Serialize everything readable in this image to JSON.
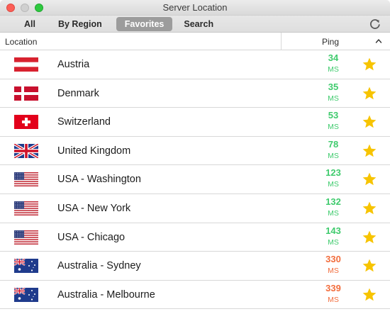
{
  "window": {
    "title": "Server Location"
  },
  "tabs": [
    {
      "label": "All"
    },
    {
      "label": "By Region"
    },
    {
      "label": "Favorites"
    },
    {
      "label": "Search"
    }
  ],
  "columns": {
    "location": "Location",
    "ping": "Ping"
  },
  "colors": {
    "ping_good": "#3fcb6d",
    "ping_bad": "#f26d3d",
    "star": "#f7c400",
    "active_tab": "#9c9c9c"
  },
  "rows": [
    {
      "flag": "austria-flag",
      "name": "Austria",
      "ping": "34",
      "unit": "MS",
      "status": "good"
    },
    {
      "flag": "denmark-flag",
      "name": "Denmark",
      "ping": "35",
      "unit": "MS",
      "status": "good"
    },
    {
      "flag": "switzerland-flag",
      "name": "Switzerland",
      "ping": "53",
      "unit": "MS",
      "status": "good"
    },
    {
      "flag": "uk-flag",
      "name": "United Kingdom",
      "ping": "78",
      "unit": "MS",
      "status": "good"
    },
    {
      "flag": "usa-flag",
      "name": "USA - Washington",
      "ping": "123",
      "unit": "MS",
      "status": "good"
    },
    {
      "flag": "usa-flag",
      "name": "USA - New York",
      "ping": "132",
      "unit": "MS",
      "status": "good"
    },
    {
      "flag": "usa-flag",
      "name": "USA - Chicago",
      "ping": "143",
      "unit": "MS",
      "status": "good"
    },
    {
      "flag": "australia-flag",
      "name": "Australia - Sydney",
      "ping": "330",
      "unit": "MS",
      "status": "bad"
    },
    {
      "flag": "australia-flag",
      "name": "Australia - Melbourne",
      "ping": "339",
      "unit": "MS",
      "status": "bad"
    }
  ]
}
